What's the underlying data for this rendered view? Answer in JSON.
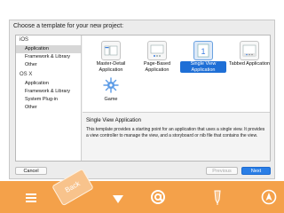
{
  "dialog": {
    "prompt": "Choose a template for your new project:",
    "sidebar": {
      "sections": [
        {
          "header": "iOS",
          "items": [
            "Application",
            "Framework & Library",
            "Other"
          ]
        },
        {
          "header": "OS X",
          "items": [
            "Application",
            "Framework & Library",
            "System Plug-in",
            "Other"
          ]
        }
      ]
    },
    "templates": [
      "Master-Detail Application",
      "Page-Based Application",
      "Single View Application",
      "Tabbed Application",
      "Game"
    ],
    "selected_template": "Single View Application",
    "selected_sidebar_item": "iOS › Application",
    "description": {
      "title": "Single View Application",
      "body": "This template provides a starting point for an application that uses a single view. It provides a view controller to manage the view, and a storyboard or nib file that contains the view."
    },
    "buttons": {
      "cancel": "Cancel",
      "previous": "Previous",
      "next": "Next"
    }
  },
  "toolbar": {
    "back_label": "Back",
    "icons": [
      "menu-icon",
      "back-tag-icon",
      "down-triangle-icon",
      "at-sign-icon",
      "pen-icon",
      "navigation-icon"
    ],
    "color": "#f4a14a"
  },
  "colors": {
    "accent": "#1f6fd6",
    "toolbar": "#f4a14a"
  }
}
